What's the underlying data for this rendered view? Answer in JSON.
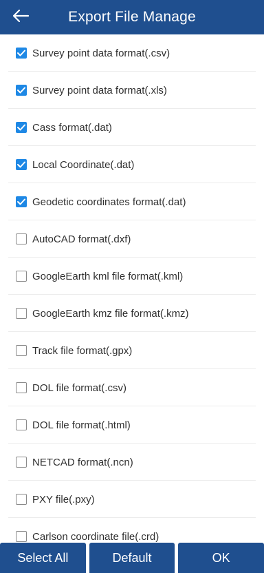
{
  "colors": {
    "header_bg": "#1f4f8f",
    "checkbox_checked": "#1e88e5",
    "text": "#303030"
  },
  "header": {
    "back_icon": "arrow-left-icon",
    "title": "Export File Manage"
  },
  "formats": [
    {
      "label": "Survey point data format(.csv)",
      "checked": true
    },
    {
      "label": "Survey point data format(.xls)",
      "checked": true
    },
    {
      "label": "Cass format(.dat)",
      "checked": true
    },
    {
      "label": "Local Coordinate(.dat)",
      "checked": true
    },
    {
      "label": "Geodetic coordinates format(.dat)",
      "checked": true
    },
    {
      "label": "AutoCAD format(.dxf)",
      "checked": false
    },
    {
      "label": "GoogleEarth kml file format(.kml)",
      "checked": false
    },
    {
      "label": "GoogleEarth kmz file format(.kmz)",
      "checked": false
    },
    {
      "label": "Track file format(.gpx)",
      "checked": false
    },
    {
      "label": "DOL file format(.csv)",
      "checked": false
    },
    {
      "label": "DOL file format(.html)",
      "checked": false
    },
    {
      "label": "NETCAD format(.ncn)",
      "checked": false
    },
    {
      "label": "PXY file(.pxy)",
      "checked": false
    },
    {
      "label": "Carlson coordinate file(.crd)",
      "checked": false
    }
  ],
  "footer": {
    "select_all": "Select All",
    "default": "Default",
    "ok": "OK"
  }
}
